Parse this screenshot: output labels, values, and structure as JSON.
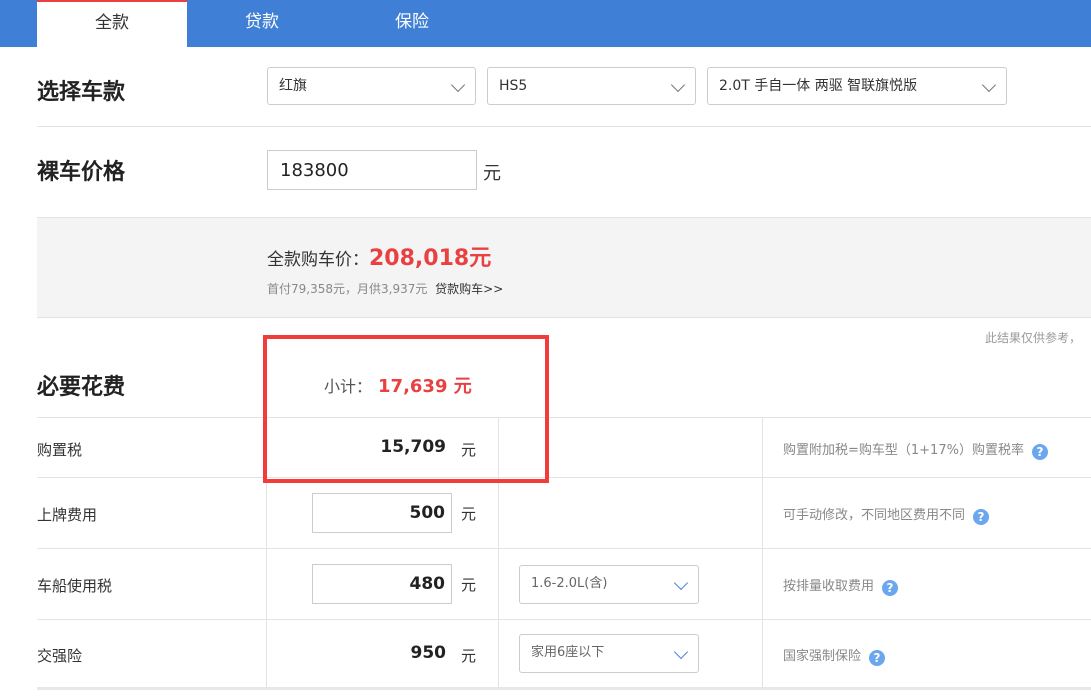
{
  "tabs": [
    {
      "label": "全款"
    },
    {
      "label": "贷款"
    },
    {
      "label": "保险"
    }
  ],
  "select_car": {
    "title": "选择车款",
    "brand": "红旗",
    "series": "HS5",
    "model": "2.0T 手自一体 两驱 智联旗悦版"
  },
  "bare_price": {
    "title": "裸车价格",
    "value": "183800",
    "unit": "元"
  },
  "summary": {
    "full_label": "全款购车价：",
    "full_value": "208,018元",
    "sub_text": "首付79,358元，月供3,937元",
    "loan_link": "贷款购车>>"
  },
  "disclaimer": "此结果仅供参考，",
  "necessary": {
    "title": "必要花费",
    "subtotal_label": "小计：",
    "subtotal_value": "17,639 元",
    "rows": [
      {
        "label": "购置税",
        "value": "15,709",
        "unit": "元",
        "note": "购置附加税=购车型（1+17%）购置税率"
      },
      {
        "label": "上牌费用",
        "value": "500",
        "unit": "元",
        "note": "可手动修改，不同地区费用不同"
      },
      {
        "label": "车船使用税",
        "value": "480",
        "unit": "元",
        "option": "1.6-2.0L(含)",
        "note": "按排量收取费用"
      },
      {
        "label": "交强险",
        "value": "950",
        "unit": "元",
        "option": "家用6座以下",
        "note": "国家强制保险"
      }
    ]
  },
  "colors": {
    "tab_bar": "#3f7fd6",
    "price_red": "#e94141",
    "highlight_box": "#f23b3b",
    "help_icon": "#6aa7ee"
  }
}
